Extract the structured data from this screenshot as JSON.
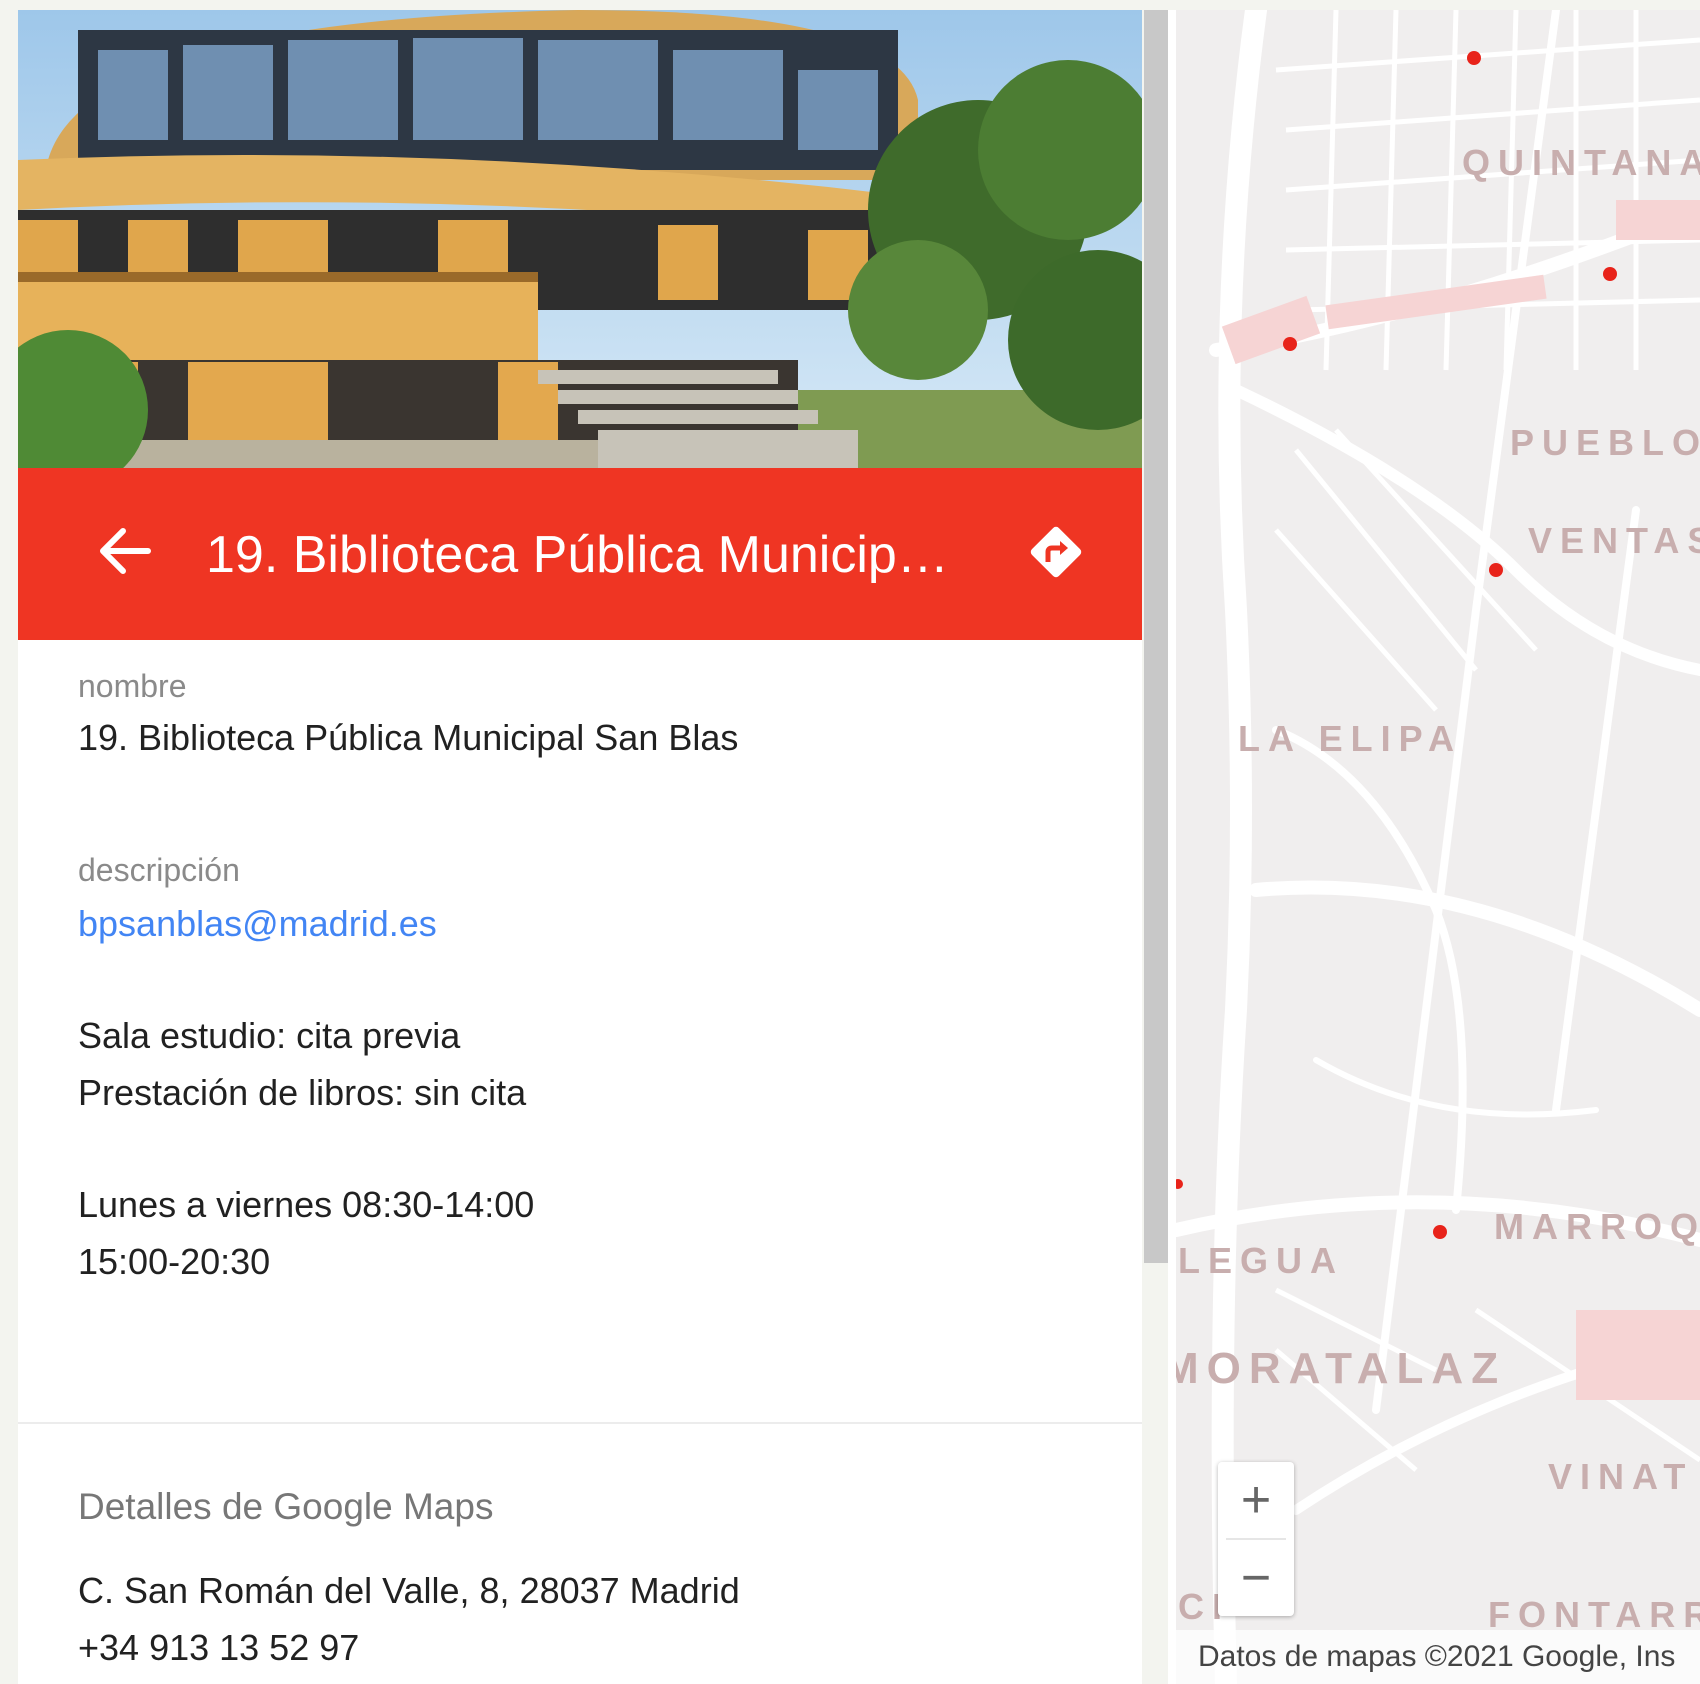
{
  "place": {
    "title": "19. Biblioteca Pública Municipal San Blas",
    "photo_alt": "Biblioteca building photo"
  },
  "fields": {
    "name_label": "nombre",
    "name_value": "19. Biblioteca Pública Municipal San Blas",
    "desc_label": "descripción",
    "email": "bpsanblas@madrid.es",
    "desc_line1": "Sala estudio: cita previa",
    "desc_line2": "Prestación de libros: sin cita",
    "hours_line1": "Lunes a viernes 08:30-14:00",
    "hours_line2": "15:00-20:30"
  },
  "google_details": {
    "section_title": "Detalles de Google Maps",
    "address": "C. San Román del Valle, 8, 28037 Madrid",
    "phone": "+34 913 13 52 97"
  },
  "map": {
    "labels": [
      "QUINTANA",
      "PUEBLO",
      "VENTAS",
      "LA ELIPA",
      "MARROQ",
      "LEGUA",
      "MORATALAZ",
      "VINAT",
      "CI",
      "FONTARR"
    ],
    "zoom_in": "+",
    "zoom_out": "−",
    "attribution": "Datos de mapas ©2021 Google, Ins",
    "marker_color": "#e8231a"
  },
  "colors": {
    "header": "#ef3523",
    "link": "#4285f4"
  },
  "icons": {
    "back": "arrow-left-icon",
    "directions": "directions-icon"
  }
}
